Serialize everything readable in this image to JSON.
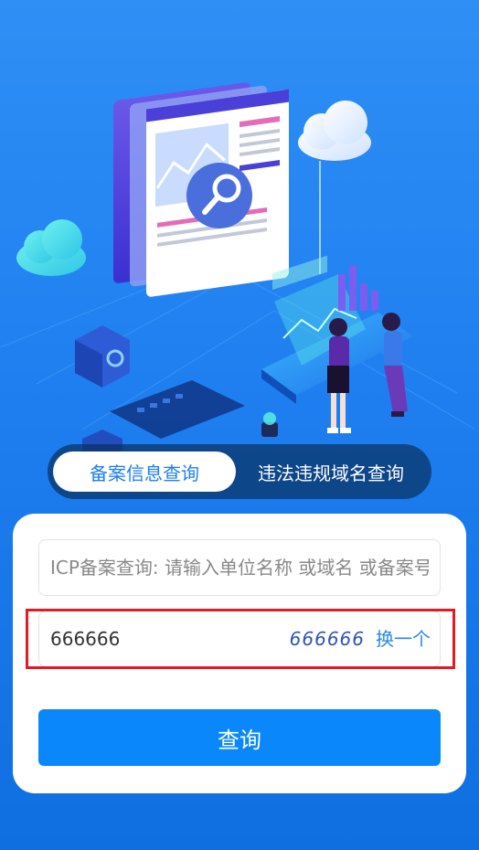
{
  "tabs": {
    "record_query": "备案信息查询",
    "violation_query": "违法违规域名查询"
  },
  "form": {
    "icp_placeholder": "ICP备案查询: 请输入单位名称 或域名 或备案号",
    "captcha_value": "666666",
    "captcha_code": "666666",
    "refresh_label": "换一个",
    "submit_label": "查询"
  },
  "colors": {
    "accent": "#1c7ef0",
    "button": "#0a88fb",
    "highlight": "#e01b24"
  }
}
